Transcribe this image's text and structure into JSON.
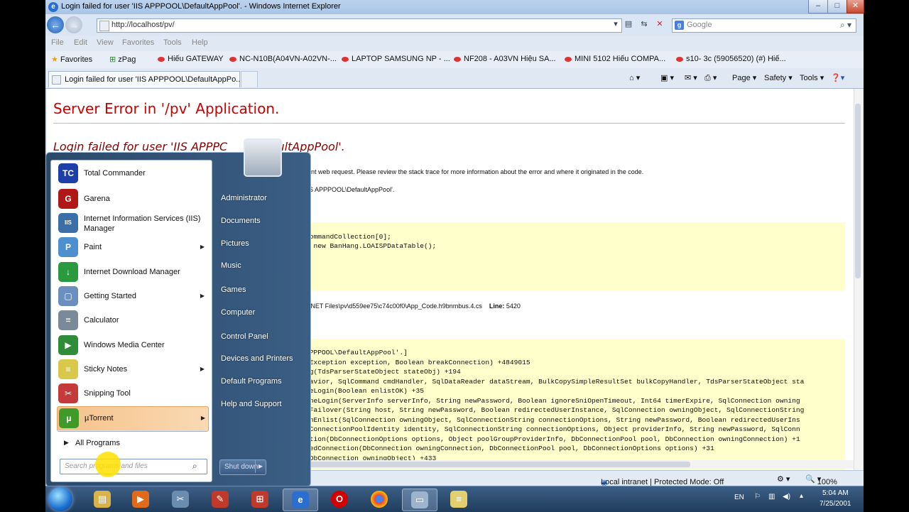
{
  "window": {
    "title": "Login failed for user 'IIS APPPOOL\\DefaultAppPool'. - Windows Internet Explorer",
    "address": "http://localhost/pv/",
    "search_placeholder": "Google"
  },
  "menu": [
    "File",
    "Edit",
    "View",
    "Favorites",
    "Tools",
    "Help"
  ],
  "favorites": {
    "label": "Favorites",
    "items": [
      "zPag",
      "Hiếu GATEWAY",
      "NC-N10B(A04VN-A02VN-...",
      "LAPTOP SAMSUNG NP - ...",
      "NF208 - A03VN  Hiệu SA...",
      "MINI 5102  Hiếu COMPA...",
      "s10- 3c (59056520) (#)  Hiế..."
    ]
  },
  "tab": {
    "title": "Login failed for user 'IIS APPPOOL\\DefaultAppPo..."
  },
  "commandbar": [
    "Page ▾",
    "Safety ▾",
    "Tools ▾"
  ],
  "page": {
    "heading": "Server Error in '/pv' Application.",
    "error_left": "Login failed for user 'IIS APPPC",
    "error_right": "efaultAppPool'.",
    "desc": "rent web request. Please review the stack trace for more information about the error and where it originated in the code.",
    "exc": "IIS APPPOOL\\DefaultAppPool'.",
    "src1": "CommandCollection[0];",
    "src2": "= new BanHang.LOAISPDataTable();",
    "file": "P.NET Files\\pv\\d559ee75\\c74c00f0\\App_Code.h9bnmbus.4.cs",
    "line_label": "Line:",
    "line_value": "5420",
    "stack": [
      "APPPOOL\\DefaultAppPool'.]",
      "lException exception, Boolean breakConnection) +4849015",
      "ng(TdsParserStateObject stateObj) +194",
      "havior, SqlCommand cmdHandler, SqlDataReader dataStream, BulkCopySimpleResultSet bulkCopyHandler, TdsParserStateObject sta",
      "ceLogin(Boolean enlistOK) +35",
      "OneLogin(ServerInfo serverInfo, String newPassword, Boolean ignoreSniOpenTimeout, Int64 timerExpire, SqlConnection owning",
      "nFailover(String host, String newPassword, Boolean redirectedUserInstance, SqlConnection owningObject, SqlConnectionString",
      "inEnlist(SqlConnection owningObject, SqlConnectionString connectionOptions, String newPassword, Boolean redirectedUserIns",
      "bConnectionPoolIdentity identity, SqlConnectionString connectionOptions, Object providerInfo, String newPassword, SqlConn",
      "ction(DbConnectionOptions options, Object poolGroupProviderInfo, DbConnectionPool pool, DbConnection owningConnection) +1",
      "ledConnection(DbConnection owningConnection, DbConnectionPool pool, DbConnectionOptions options) +31",
      "(DbConnection owningObject) +433"
    ]
  },
  "status": {
    "zone": "Local intranet | Protected Mode: Off",
    "zoom": "100%"
  },
  "startmenu": {
    "programs": [
      {
        "label": "Total Commander",
        "icon": "floppy-icon",
        "color": "#1f3fa8",
        "glyph": "TC"
      },
      {
        "label": "Garena",
        "icon": "garena-icon",
        "color": "#b01818",
        "glyph": "G"
      },
      {
        "label": "Internet Information Services (IIS) Manager",
        "icon": "iis-icon",
        "color": "#3c6ea8",
        "glyph": "IIS"
      },
      {
        "label": "Paint",
        "icon": "paint-icon",
        "color": "#4e8fd0",
        "glyph": "P",
        "arrow": true
      },
      {
        "label": "Internet Download Manager",
        "icon": "idm-icon",
        "color": "#2a9a3e",
        "glyph": "↓"
      },
      {
        "label": "Getting Started",
        "icon": "getting-started-icon",
        "color": "#6b8fbf",
        "glyph": "▢",
        "arrow": true
      },
      {
        "label": "Calculator",
        "icon": "calculator-icon",
        "color": "#7b8a99",
        "glyph": "="
      },
      {
        "label": "Windows Media Center",
        "icon": "media-center-icon",
        "color": "#2f8d3a",
        "glyph": "▶"
      },
      {
        "label": "Sticky Notes",
        "icon": "sticky-notes-icon",
        "color": "#d8c94a",
        "glyph": "≡",
        "arrow": true
      },
      {
        "label": "Snipping Tool",
        "icon": "snipping-tool-icon",
        "color": "#c43a3a",
        "glyph": "✂"
      },
      {
        "label": "µTorrent",
        "icon": "utorrent-icon",
        "color": "#3f9a2a",
        "glyph": "µ",
        "arrow": true
      }
    ],
    "all_programs": "All Programs",
    "search_placeholder": "Search programs and files",
    "right": [
      "Administrator",
      "Documents",
      "Pictures",
      "Music",
      "Games",
      "Computer",
      "Control Panel",
      "Devices and Printers",
      "Default Programs",
      "Help and Support"
    ],
    "shutdown": "Shut down"
  },
  "taskbar": {
    "lang": "EN",
    "time": "5:04 AM",
    "date": "7/25/2001"
  }
}
